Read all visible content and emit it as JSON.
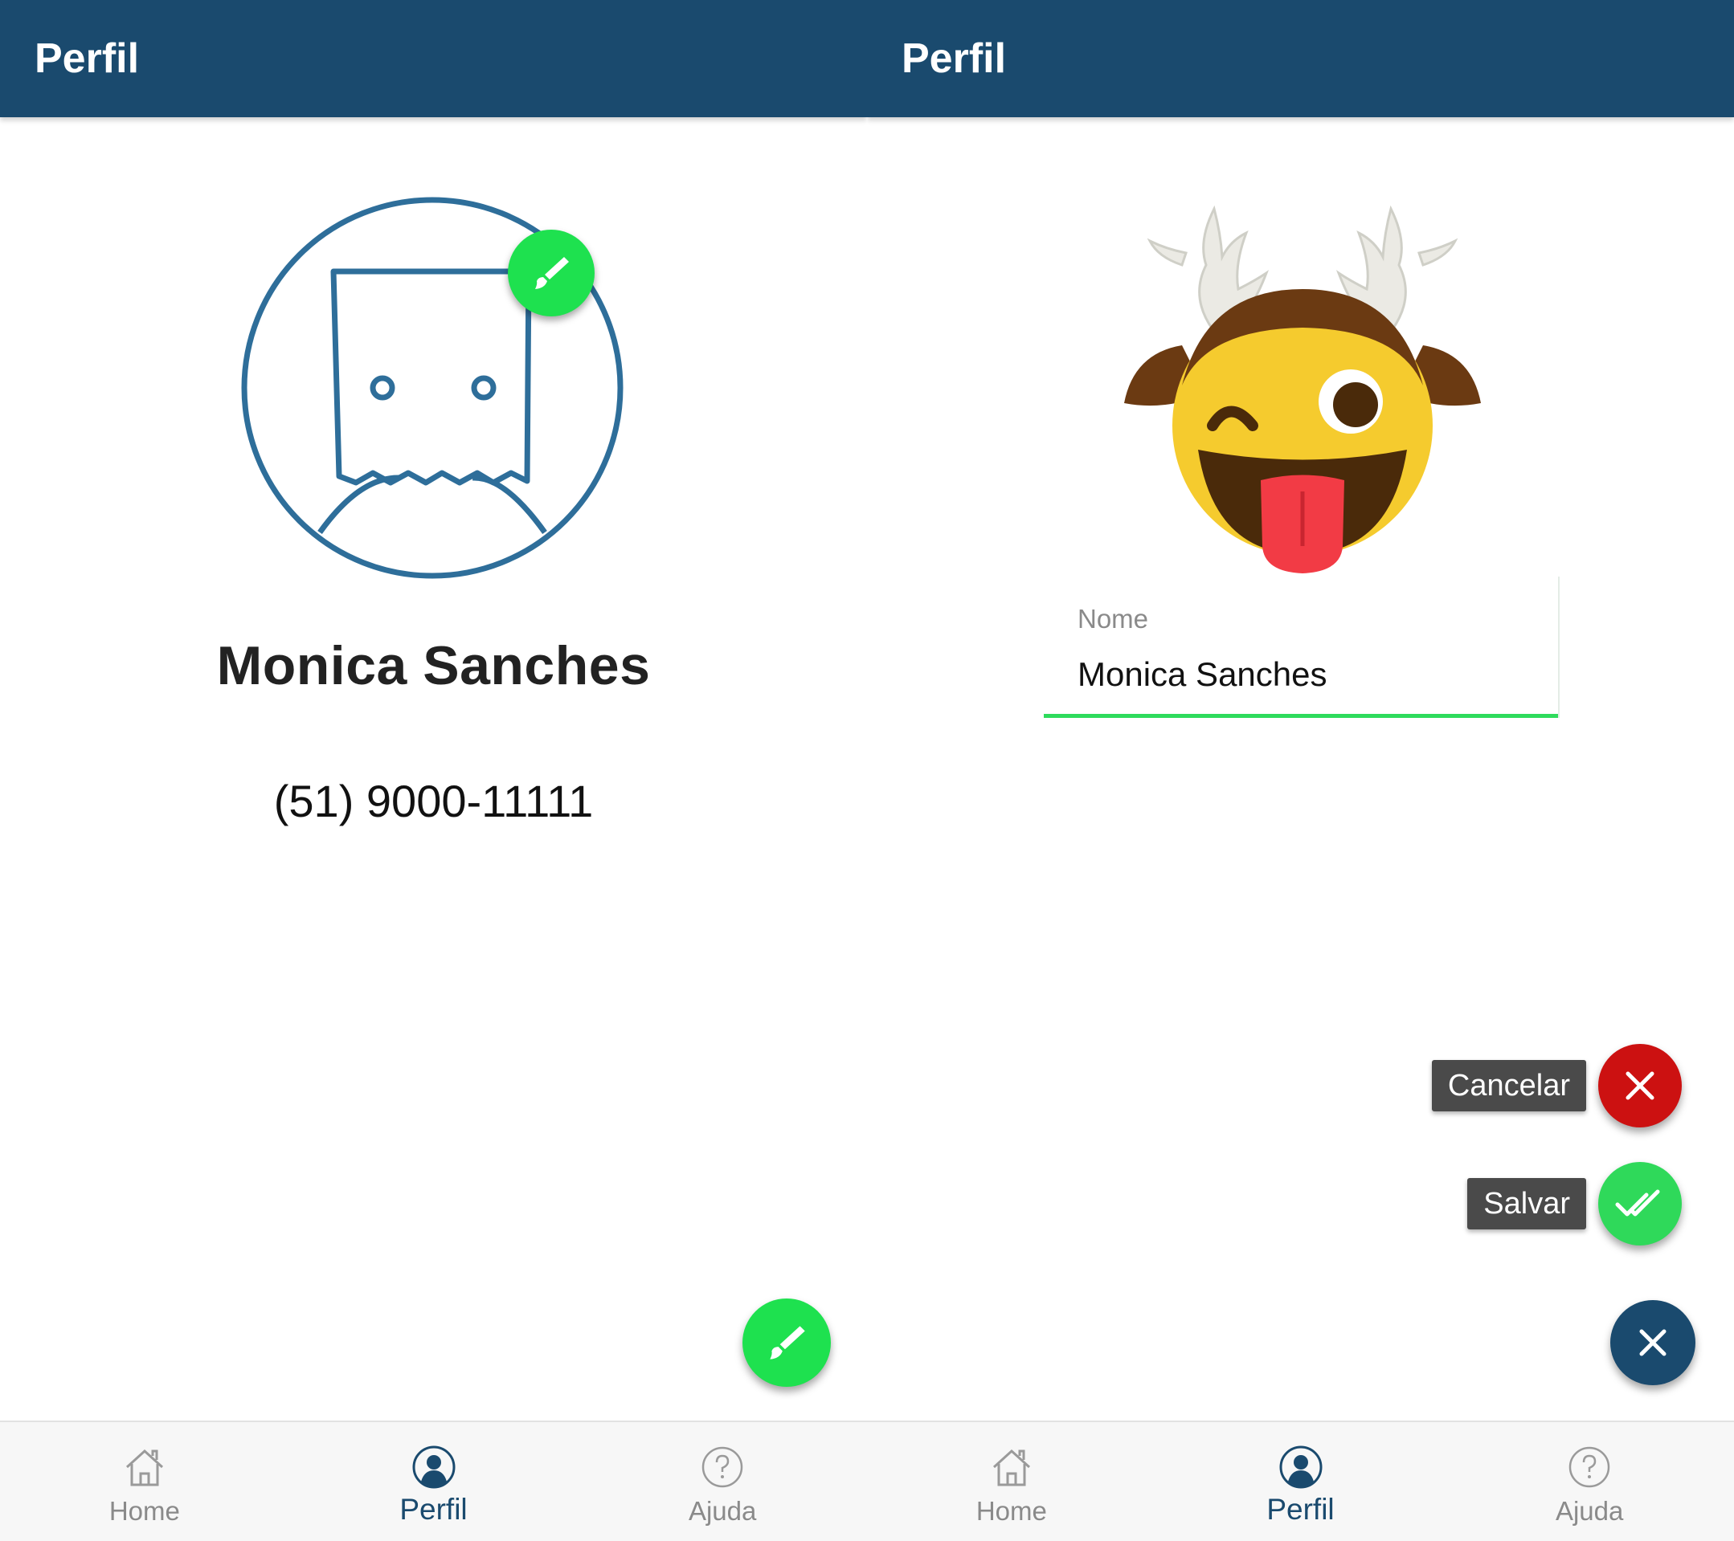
{
  "left_screen": {
    "appbar": {
      "title": "Perfil"
    },
    "profile": {
      "name": "Monica Sanches",
      "phone": "(51) 9000-11111",
      "avatar_icon": "paper-bag-face-avatar-icon"
    },
    "edit_badge_icon": "paintbrush-icon",
    "fab_icon": "paintbrush-icon",
    "bottom_nav": [
      {
        "label": "Home",
        "icon": "home-icon",
        "active": false
      },
      {
        "label": "Perfil",
        "icon": "user-icon",
        "active": true
      },
      {
        "label": "Ajuda",
        "icon": "help-icon",
        "active": false
      }
    ]
  },
  "right_screen": {
    "appbar": {
      "title": "Perfil"
    },
    "avatar_icon": "reindeer-winking-emoji",
    "name_field": {
      "label": "Nome",
      "value": "Monica Sanches"
    },
    "speed_dial": {
      "cancel_label": "Cancelar",
      "save_label": "Salvar",
      "cancel_icon": "close-icon",
      "save_icon": "double-check-icon",
      "close_icon": "close-icon"
    },
    "bottom_nav": [
      {
        "label": "Home",
        "icon": "home-icon",
        "active": false
      },
      {
        "label": "Perfil",
        "icon": "user-icon",
        "active": true
      },
      {
        "label": "Ajuda",
        "icon": "help-icon",
        "active": false
      }
    ]
  },
  "colors": {
    "primary": "#1a4a6e",
    "accent_green": "#1ee14f",
    "cancel_red": "#cc1111",
    "nav_background": "#f7f7f7"
  }
}
